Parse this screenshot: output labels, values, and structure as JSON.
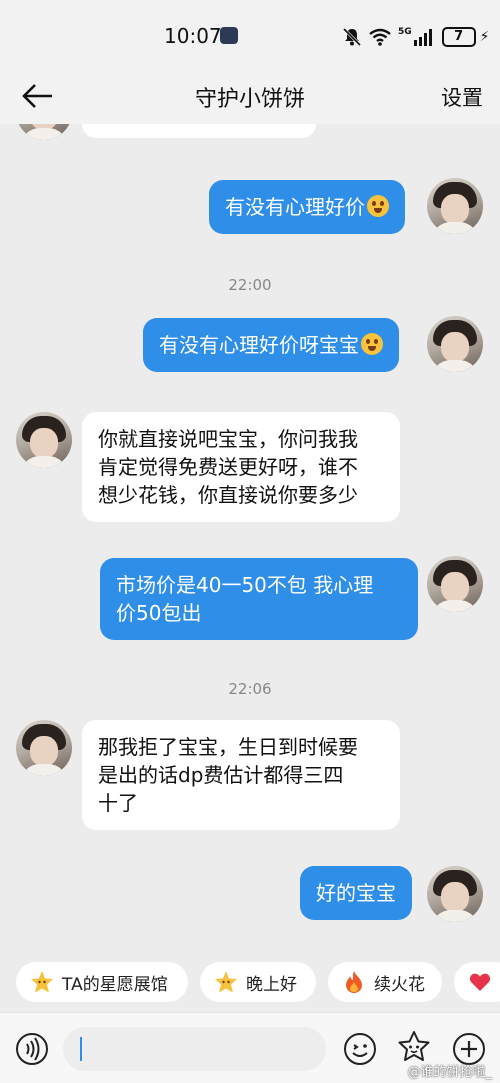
{
  "status_bar": {
    "time": "10:07",
    "network": "5G",
    "battery": "7",
    "icons": [
      "mute-bell-icon",
      "wifi-icon",
      "signal-icon",
      "battery-icon",
      "charging-bolt-icon"
    ]
  },
  "header": {
    "back_icon": "arrow-left-icon",
    "title": "守护小饼饼",
    "settings_label": "设置"
  },
  "messages": [
    {
      "side": "out",
      "text": "有没有心理好价",
      "emoji": "heart-eyes-emoji"
    },
    {
      "timestamp": "22:00"
    },
    {
      "side": "out",
      "text": "有没有心理好价呀宝宝",
      "emoji": "heart-eyes-emoji"
    },
    {
      "side": "in",
      "lines": [
        "你就直接说吧宝宝，你问我我",
        "肯定觉得免费送更好呀，谁不",
        "想少花钱，你直接说你要多少"
      ]
    },
    {
      "side": "out",
      "lines": [
        "市场价是40一50不包 我心理",
        "价50包出"
      ]
    },
    {
      "timestamp": "22:06"
    },
    {
      "side": "in",
      "lines": [
        "那我拒了宝宝，生日到时候要",
        "是出的话dp费估计都得三四",
        "十了"
      ]
    },
    {
      "side": "out",
      "text": "好的宝宝"
    }
  ],
  "quick_chips": [
    {
      "icon": "star-face-icon",
      "label": "TA的星愿展馆"
    },
    {
      "icon": "star-face-icon",
      "label": "晚上好"
    },
    {
      "icon": "fire-icon",
      "label": "续火花"
    },
    {
      "icon": "heart-icon",
      "label": ""
    }
  ],
  "input_bar": {
    "voice_icon": "voice-icon",
    "placeholder": "",
    "emoji_icon": "smiley-icon",
    "sticker_icon": "star-sticker-icon",
    "plus_icon": "plus-circle-icon"
  },
  "watermark": "@谁的饼抢啦_",
  "colors": {
    "outgoing_bubble": "#2f8ee8",
    "incoming_bubble": "#ffffff",
    "background": "#ececec"
  }
}
